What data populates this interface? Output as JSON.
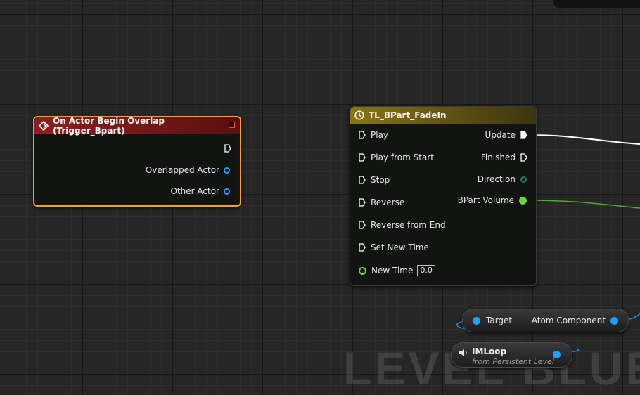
{
  "watermark": "LEVEL BLUEPRINT",
  "colors": {
    "exec_pin": "#ffffff",
    "object_pin": "#1ea0ff",
    "float_pin": "#6cd33c",
    "direction_pin": "#1e7a6a",
    "event_border": "#f5a020",
    "event_header": "#8f1f1f",
    "timeline_header": "#8a7514"
  },
  "event_node": {
    "title": "On Actor Begin Overlap (Trigger_Bpart)",
    "header_icon": "event-diamond-icon",
    "outputs": [
      "Overlapped Actor",
      "Other Actor"
    ]
  },
  "timeline_node": {
    "title": "TL_BPart_FadeIn",
    "header_icon": "clock-icon",
    "inputs": [
      "Play",
      "Play from Start",
      "Stop",
      "Reverse",
      "Reverse from End",
      "Set New Time"
    ],
    "new_time_label": "New Time",
    "new_time_value": "0.0",
    "outputs": [
      "Update",
      "Finished",
      "Direction",
      "BPart Volume"
    ]
  },
  "atom_node": {
    "target_label": "Target",
    "output_label": "Atom Component"
  },
  "imloop_node": {
    "title": "IMLoop",
    "subtitle": "from Persistent Level",
    "icon": "speaker-icon"
  }
}
